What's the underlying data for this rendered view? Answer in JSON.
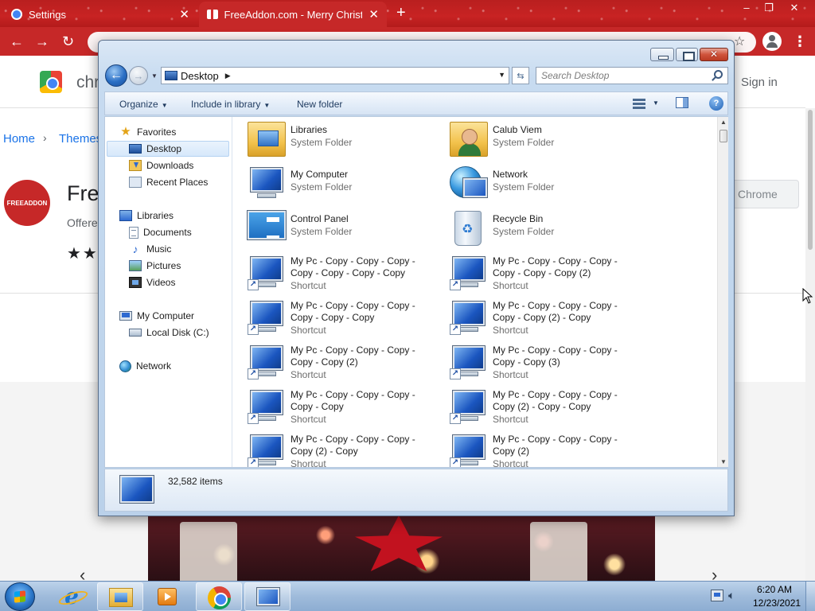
{
  "browser": {
    "tabs": [
      {
        "label": "Settings",
        "active": false
      },
      {
        "label": "FreeAddon.com - Merry Christm",
        "active": true
      }
    ],
    "window_controls": {
      "minimize": "–",
      "restore": "❐",
      "close": "✕"
    },
    "new_tab": "+"
  },
  "store": {
    "title": "chrome web store",
    "signin": "Sign in",
    "breadcrumb": [
      "Home",
      "Themes"
    ],
    "breadcrumb_sep": "›",
    "extension": {
      "logo_text": "FREEADDON",
      "name": "Free",
      "offered": "Offere",
      "stars": "★★",
      "add_button": "Chrome"
    },
    "carousel": {
      "prev": "‹",
      "next": "›"
    }
  },
  "explorer": {
    "address": "Desktop",
    "search_placeholder": "Search Desktop",
    "toolbar": {
      "organize": "Organize",
      "include_library": "Include in library",
      "new_folder": "New folder"
    },
    "nav": {
      "favorites": "Favorites",
      "desktop": "Desktop",
      "downloads": "Downloads",
      "recent_places": "Recent Places",
      "libraries": "Libraries",
      "documents": "Documents",
      "music": "Music",
      "pictures": "Pictures",
      "videos": "Videos",
      "my_computer": "My Computer",
      "local_disk": "Local Disk (C:)",
      "network": "Network"
    },
    "items": [
      {
        "name": "Libraries",
        "kind": "System Folder"
      },
      {
        "name": "Calub Viem",
        "kind": "System Folder"
      },
      {
        "name": "My Computer",
        "kind": "System Folder"
      },
      {
        "name": "Network",
        "kind": "System Folder"
      },
      {
        "name": "Control Panel",
        "kind": "System Folder"
      },
      {
        "name": "Recycle Bin",
        "kind": "System Folder"
      },
      {
        "name": "My Pc - Copy - Copy - Copy - Copy - Copy - Copy - Copy",
        "kind": "Shortcut"
      },
      {
        "name": "My Pc - Copy - Copy - Copy - Copy - Copy - Copy (2)",
        "kind": "Shortcut"
      },
      {
        "name": "My Pc - Copy - Copy - Copy - Copy - Copy - Copy",
        "kind": "Shortcut"
      },
      {
        "name": "My Pc - Copy - Copy - Copy - Copy - Copy (2) - Copy",
        "kind": "Shortcut"
      },
      {
        "name": "My Pc - Copy - Copy - Copy - Copy - Copy (2)",
        "kind": "Shortcut"
      },
      {
        "name": "My Pc - Copy - Copy - Copy - Copy - Copy (3)",
        "kind": "Shortcut"
      },
      {
        "name": "My Pc - Copy - Copy - Copy - Copy - Copy",
        "kind": "Shortcut"
      },
      {
        "name": "My Pc - Copy - Copy - Copy - Copy (2) - Copy - Copy",
        "kind": "Shortcut"
      },
      {
        "name": "My Pc - Copy - Copy - Copy - Copy (2) - Copy",
        "kind": "Shortcut"
      },
      {
        "name": "My Pc - Copy - Copy - Copy - Copy (2)",
        "kind": "Shortcut"
      }
    ],
    "status": "32,582 items"
  },
  "taskbar": {
    "time": "6:20 AM",
    "date": "12/23/2021"
  },
  "colors": {
    "chrome_red": "#c62828",
    "link_blue": "#1a73e8",
    "taskbar_blue": "#9fbbdb"
  }
}
